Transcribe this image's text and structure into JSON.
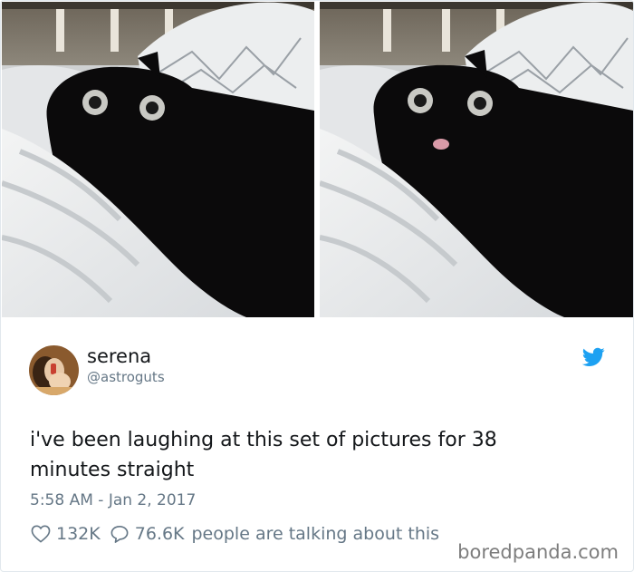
{
  "tweet": {
    "user": {
      "display_name": "serena",
      "handle": "@astroguts"
    },
    "text": "i've been laughing at this set of pictures for 38 minutes straight",
    "timestamp": "5:58 AM - Jan 2, 2017",
    "likes": "132K",
    "replies": "76.6K",
    "talking_label": "people are talking about this"
  },
  "media": {
    "photos": [
      "cat-photo-eyes-open",
      "cat-photo-tongue-out"
    ]
  },
  "branding": {
    "twitter_icon": "twitter-bird-icon",
    "twitter_color": "#1da1f2",
    "watermark": "boredpanda.com"
  }
}
